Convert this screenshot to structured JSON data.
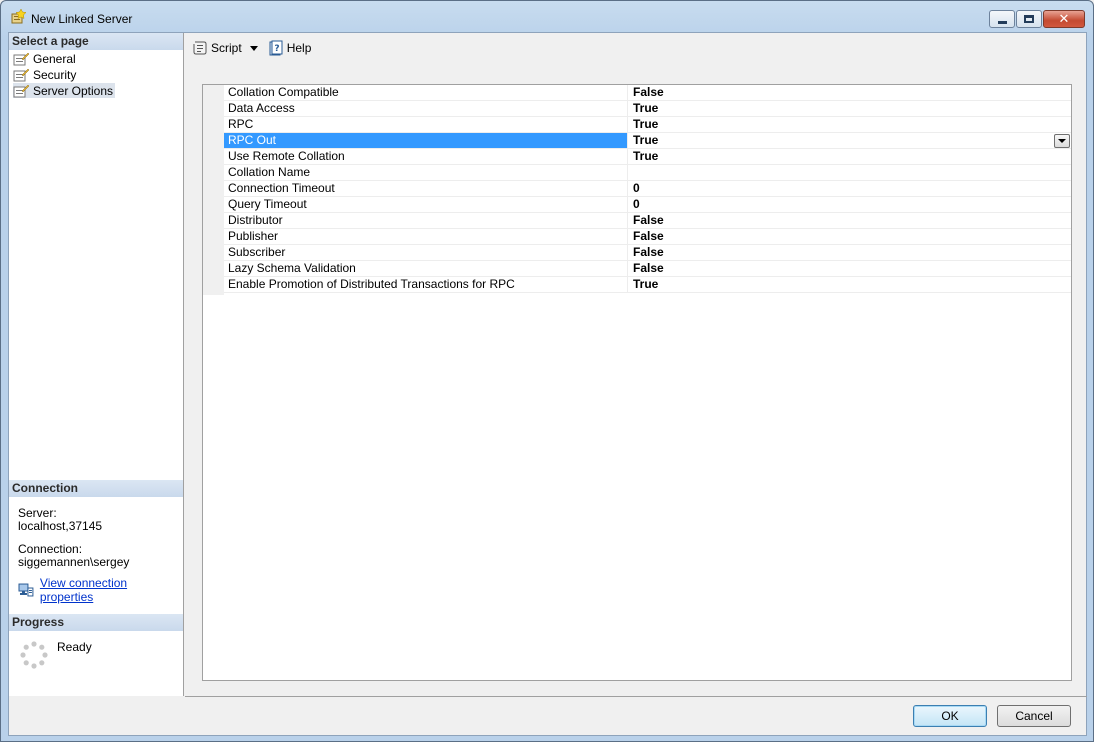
{
  "window": {
    "title": "New Linked Server"
  },
  "left_pane": {
    "select_page_header": "Select a page",
    "pages": [
      {
        "label": "General",
        "selected": false
      },
      {
        "label": "Security",
        "selected": false
      },
      {
        "label": "Server Options",
        "selected": true
      }
    ],
    "connection_header": "Connection",
    "server_label": "Server:",
    "server_value": "localhost,37145",
    "connection_label": "Connection:",
    "connection_value": "siggemannen\\sergey",
    "view_props_link": "View connection properties",
    "progress_header": "Progress",
    "progress_status": "Ready"
  },
  "toolbar": {
    "script_label": "Script",
    "help_label": "Help"
  },
  "properties": [
    {
      "name": "Collation Compatible",
      "value": "False"
    },
    {
      "name": "Data Access",
      "value": "True"
    },
    {
      "name": "RPC",
      "value": "True"
    },
    {
      "name": "RPC Out",
      "value": "True",
      "selected": true
    },
    {
      "name": "Use Remote Collation",
      "value": "True"
    },
    {
      "name": "Collation Name",
      "value": ""
    },
    {
      "name": "Connection Timeout",
      "value": "0"
    },
    {
      "name": "Query Timeout",
      "value": "0"
    },
    {
      "name": "Distributor",
      "value": "False"
    },
    {
      "name": "Publisher",
      "value": "False"
    },
    {
      "name": "Subscriber",
      "value": "False"
    },
    {
      "name": "Lazy Schema Validation",
      "value": "False"
    },
    {
      "name": "Enable Promotion of Distributed Transactions for RPC",
      "value": "True"
    }
  ],
  "buttons": {
    "ok": "OK",
    "cancel": "Cancel"
  },
  "colors": {
    "selection": "#3399ff",
    "link": "#0033cc",
    "section_header": "#c9d9ec"
  }
}
